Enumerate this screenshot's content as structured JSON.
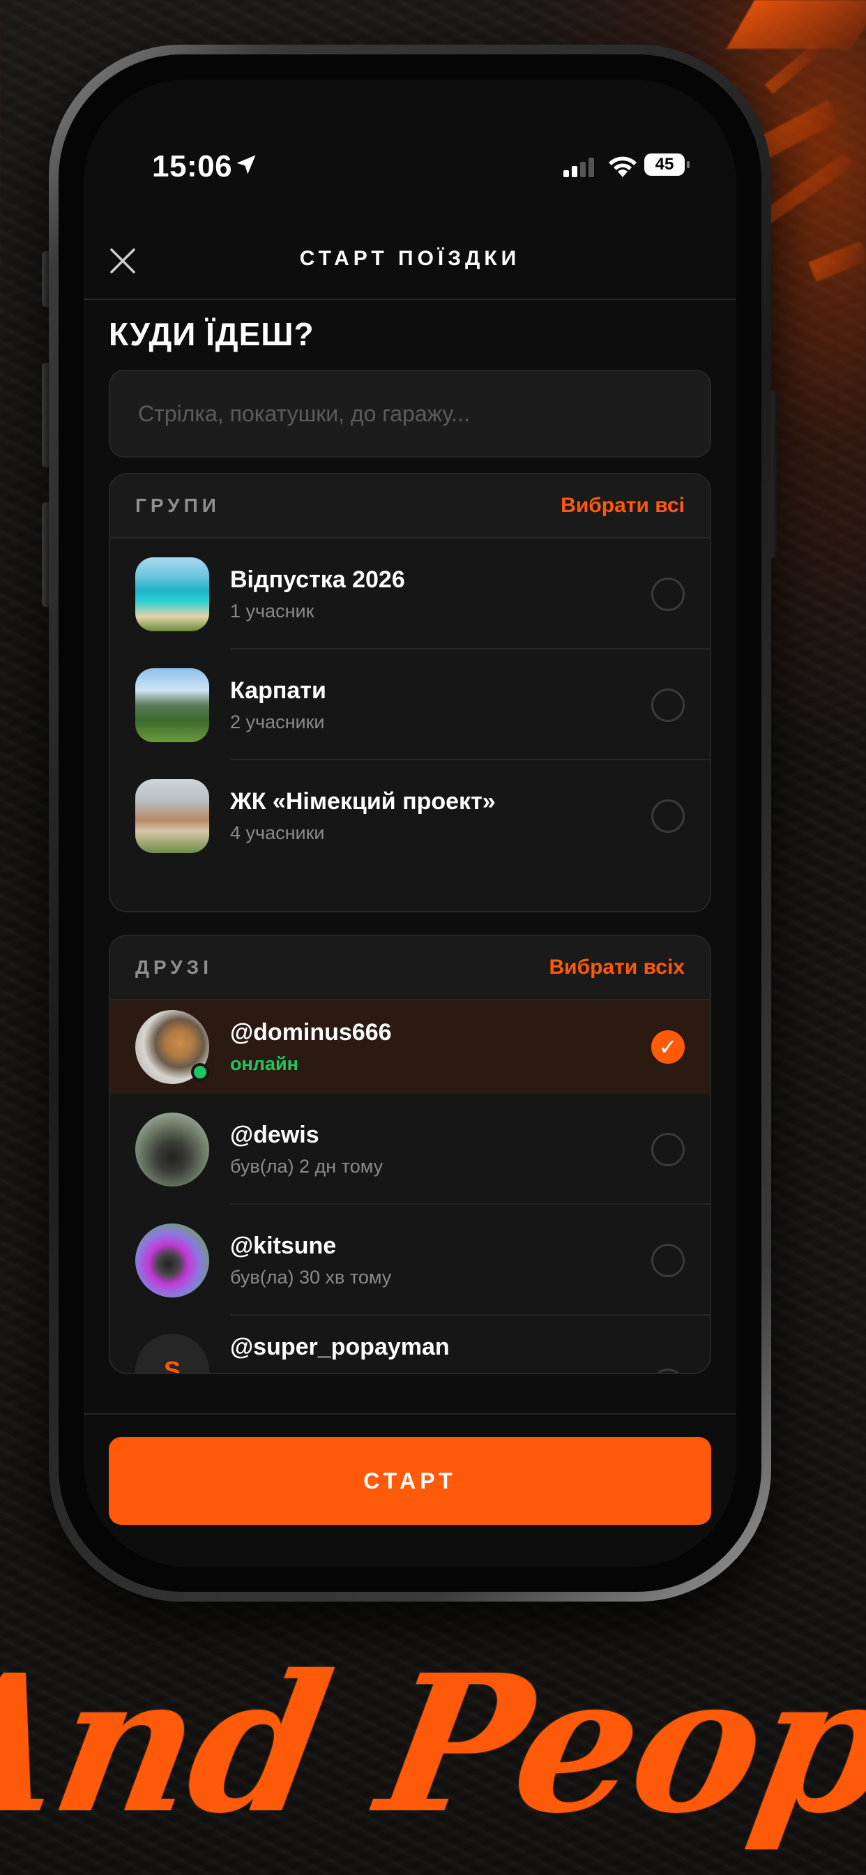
{
  "status_bar": {
    "time": "15:06",
    "battery": "45"
  },
  "header": {
    "title": "СТАРТ ПОЇЗДКИ"
  },
  "destination": {
    "heading": "КУДИ ЇДЕШ?",
    "placeholder": "Стрілка, покатушки, до гаражу..."
  },
  "groups": {
    "label": "ГРУПИ",
    "select_all": "Вибрати всі",
    "items": [
      {
        "name": "Відпустка 2026",
        "sub": "1 учасник",
        "selected": false
      },
      {
        "name": "Карпати",
        "sub": "2 учасники",
        "selected": false
      },
      {
        "name": "ЖК «Німекций проект»",
        "sub": "4 учасники",
        "selected": false
      }
    ]
  },
  "friends": {
    "label": "ДРУЗІ",
    "select_all": "Вибрати всіх",
    "items": [
      {
        "name": "@dominus666",
        "sub": "онлайн",
        "selected": true,
        "online": true
      },
      {
        "name": "@dewis",
        "sub": "був(ла) 2 дн тому",
        "selected": false
      },
      {
        "name": "@kitsune",
        "sub": "був(ла) 30 хв тому",
        "selected": false
      },
      {
        "name": "@super_popayman",
        "avatar_letter": "S",
        "selected": false
      }
    ]
  },
  "start_button": "СТАРТ",
  "check_glyph": "✓",
  "promo_text": "And People",
  "colors": {
    "accent": "#ff5a0a",
    "online": "#22c55e",
    "background": "#0d0d0d",
    "card": "#161616"
  },
  "icons": [
    "location-arrow-icon",
    "signal-icon",
    "wifi-icon",
    "battery-icon",
    "close-icon",
    "check-icon"
  ]
}
